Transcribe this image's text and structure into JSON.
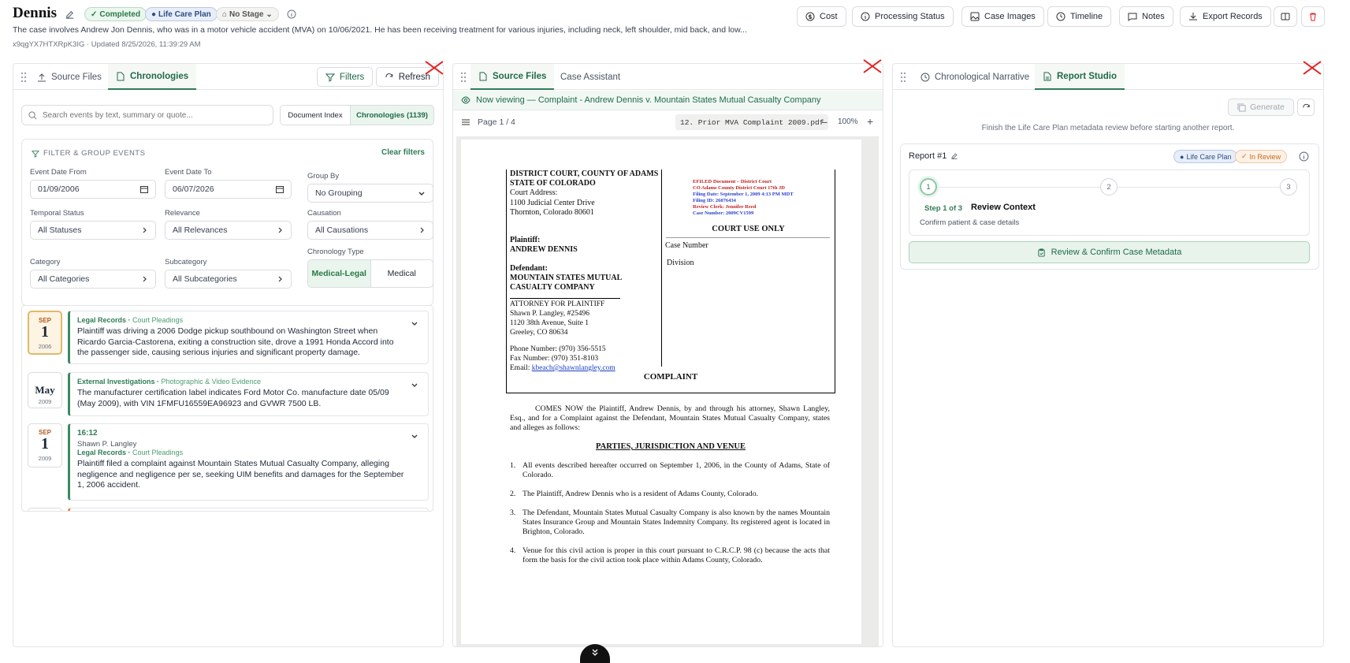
{
  "header": {
    "title": "Dennis",
    "badges": {
      "status": "Completed",
      "plan": "Life Care Plan",
      "stage": "No Stage"
    },
    "description": "The case involves Andrew Jon Dennis, who was in a motor vehicle accident (MVA) on 10/06/2021. He has been receiving treatment for various injuries, including neck, left shoulder, mid back, and low...",
    "meta": "x9qgYX7HTXRpK3IG · Updated 8/25/2026, 11:39:29 AM",
    "buttons": {
      "cost": "Cost",
      "processing": "Processing Status",
      "images": "Case Images",
      "timeline": "Timeline",
      "notes": "Notes",
      "export": "Export Records"
    }
  },
  "left": {
    "tabs": {
      "source": "Source Files",
      "chron": "Chronologies"
    },
    "filters_btn": "Filters",
    "refresh_btn": "Refresh",
    "search_placeholder": "Search events by text, summary or quote...",
    "seg": {
      "index": "Document Index",
      "chron": "Chronologies (1139)"
    },
    "filter_group": {
      "title": "FILTER & GROUP EVENTS",
      "clear": "Clear filters",
      "labels": {
        "from": "Event Date From",
        "to": "Event Date To",
        "group": "Group By",
        "temporal": "Temporal Status",
        "relevance": "Relevance",
        "causation": "Causation",
        "category": "Category",
        "subcategory": "Subcategory",
        "ctype": "Chronology Type"
      },
      "values": {
        "from": "01/09/2006",
        "to": "06/07/2026",
        "group": "No Grouping",
        "temporal": "All Statuses",
        "relevance": "All Relevances",
        "causation": "All Causations",
        "category": "All Categories",
        "subcategory": "All Subcategories"
      },
      "ctype": {
        "a": "Medical-Legal",
        "b": "Medical"
      }
    },
    "events": [
      {
        "mon": "SEP",
        "day": "1",
        "yr": "2006",
        "cat": "Legal Records",
        "sub": "Court Pleadings",
        "text": "Plaintiff was driving a 2006 Dodge pickup southbound on Washington Street when Ricardo Garcia-Castorena, exiting a construction site, drove a 1991 Honda Accord into the passenger side, causing serious injuries and significant property damage."
      },
      {
        "month": "May",
        "yr": "2009",
        "cat": "External Investigations",
        "sub": "Photographic & Video Evidence",
        "text": "The manufacturer certification label indicates Ford Motor Co. manufacture date 05/09 (May 2009), with VIN 1FMFU16559EA96923 and GVWR 7500 LB."
      },
      {
        "mon": "SEP",
        "day": "1",
        "yr": "2009",
        "time": "16:12",
        "author": "Shawn P. Langley",
        "cat": "Legal Records",
        "sub": "Court Pleadings",
        "text": "Plaintiff filed a complaint against Mountain States Mutual Casualty Company, alleging negligence and negligence per se, seeking UIM benefits and damages for the September 1, 2006 accident."
      }
    ]
  },
  "middle": {
    "tabs": {
      "source": "Source Files",
      "assistant": "Case Assistant"
    },
    "banner": "Now viewing — Complaint - Andrew Dennis v. Mountain States Mutual Casualty Company",
    "page": "Page 1 / 4",
    "file": "12. Prior MVA Complaint 2009.pdf",
    "zoom": "100%",
    "doc": {
      "court": [
        "DISTRICT COURT, COUNTY OF ADAMS",
        "STATE OF COLORADO"
      ],
      "court_addr": [
        "Court Address:",
        "1100 Judicial Center Drive",
        "Thornton, Colorado 80601"
      ],
      "plaintiff_lbl": "Plaintiff:",
      "plaintiff": "ANDREW DENNIS",
      "defendant_lbl": "Defendant:",
      "defendant": [
        "MOUNTAIN STATES MUTUAL",
        "CASUALTY COMPANY"
      ],
      "atty": [
        "ATTORNEY FOR PLAINTIFF",
        "Shawn P. Langley, #25496",
        "1120 38th Avenue, Suite 1",
        "Greeley, CO 80634"
      ],
      "phone": "Phone Number: (970) 356-5515",
      "fax": "Fax Number:     (970) 351-8103",
      "email_lbl": "Email: ",
      "email": "kbeach@shawnlangley.com",
      "stamp": [
        "EFILED Document – District Court",
        "CO Adams County District Court 17th JD",
        "Filing Date: September 1, 2009 4:13 PM MDT",
        "Filing ID: 26876434",
        "Review Clerk: Jennifer Reed",
        "Case Number: 2009CV1599"
      ],
      "cuo": "COURT USE ONLY",
      "case_no": "Case Number",
      "division": "Division",
      "heading": "COMPLAINT",
      "intro": "COMES NOW the Plaintiff, Andrew Dennis, by and through his attorney, Shawn Langley, Esq., and for a Complaint against the Defendant, Mountain States Mutual Casualty Company, states and alleges as follows:",
      "section": "PARTIES, JURISDICTION AND VENUE",
      "items": [
        "All events described hereafter occurred on September 1, 2006, in the County of Adams, State of Colorado.",
        "The Plaintiff, Andrew Dennis who is a resident of Adams County, Colorado.",
        "The Defendant, Mountain States Mutual Casualty Company is also known by the names Mountain States Insurance Group and Mountain States Indemnity Company. Its registered agent is located in Brighton, Colorado.",
        "Venue for this civil action is proper in this court pursuant to C.R.C.P. 98 (c) because the acts that form the basis for the civil action took place within Adams County, Colorado."
      ]
    }
  },
  "right": {
    "tabs": {
      "narrative": "Chronological Narrative",
      "studio": "Report Studio"
    },
    "generate": "Generate",
    "note": "Finish the Life Care Plan metadata review before starting another report.",
    "report": {
      "title": "Report #1",
      "badge_plan": "Life Care Plan",
      "badge_review": "In Review",
      "steps": [
        "1",
        "2",
        "3"
      ],
      "step_label": "Step 1 of 3",
      "step_title": "Review Context",
      "step_desc": "Confirm patient & case details",
      "confirm": "Review & Confirm Case Metadata"
    }
  },
  "colors": {
    "accent": "#2f7d57",
    "close": "#e0201f"
  }
}
